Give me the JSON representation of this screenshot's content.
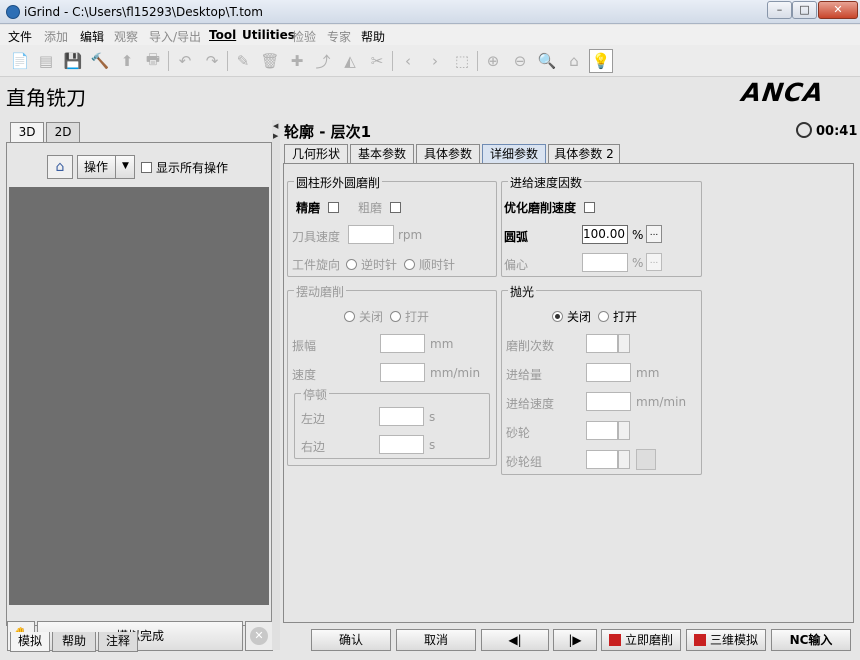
{
  "window": {
    "title": "iGrind - C:\\Users\\fl15293\\Desktop\\T.tom",
    "min": "–",
    "max": "□",
    "close": "✕"
  },
  "menu": [
    {
      "label": "文件",
      "enabled": true
    },
    {
      "label": "添加",
      "enabled": false
    },
    {
      "label": "编辑",
      "enabled": true
    },
    {
      "label": "观察",
      "enabled": false
    },
    {
      "label": "导入/导出",
      "enabled": false
    },
    {
      "label": "Tool",
      "enabled": true
    },
    {
      "label": "Utilities",
      "enabled": true
    },
    {
      "label": "检验",
      "enabled": false
    },
    {
      "label": "专家",
      "enabled": false
    },
    {
      "label": "帮助",
      "enabled": true
    }
  ],
  "toolbar": {
    "new": "📄",
    "open": "▤",
    "save": "💾",
    "tool": "🔨",
    "export": "⬆",
    "print": "🖶",
    "undo": "↶",
    "redo": "↷",
    "edit": "✎",
    "delete": "🗑",
    "add": "✚",
    "sweep": "⤴",
    "mirror": "◭",
    "cut": "✂",
    "prev": "‹",
    "next": "›",
    "fit": "⬚",
    "zoom_in": "⊕",
    "zoom_out": "⊖",
    "zoom": "🔍",
    "home": "⌂",
    "tip": "💡"
  },
  "page_title": "直角铣刀",
  "brand": "ANCA",
  "left": {
    "tabs": [
      "3D",
      "2D"
    ],
    "home_icon": "⌂",
    "operation": "操作",
    "dropdown_arrow": "▼",
    "show_all": "显示所有操作",
    "hand_icon": "✋",
    "sim_done": "模拟完成",
    "stop_icon": "✕",
    "bottom_tabs": [
      "模拟",
      "帮助",
      "注释"
    ]
  },
  "splitter": {
    "left_arrow": "◀",
    "right_arrow": "▶"
  },
  "section_title": "轮廓  - 层次1",
  "timer": "00:41",
  "tabs": [
    "几何形状",
    "基本参数",
    "具体参数",
    "详细参数",
    "具体参数 2"
  ],
  "selected_tab": 3,
  "cyl": {
    "title": "圆柱形外圆磨削",
    "finish": "精磨",
    "rough": "粗磨",
    "wheel_speed": "刀具速度",
    "wheel_speed_unit": "rpm",
    "work_dir": "工件旋向",
    "ccw": "逆时针",
    "cw": "顺时针"
  },
  "feed": {
    "title": "进给速度因数",
    "optimize": "优化磨削速度",
    "arc": "圆弧",
    "arc_value": "100.00",
    "arc_unit": "%",
    "eccentric": "偏心",
    "ecc_unit": "%",
    "dots": "..."
  },
  "osc": {
    "title": "摆动磨削",
    "off": "关闭",
    "on": "打开",
    "amp": "振幅",
    "amp_unit": "mm",
    "speed": "速度",
    "speed_unit": "mm/min",
    "dwell": "停顿",
    "left": "左边",
    "left_unit": "s",
    "right": "右边",
    "right_unit": "s"
  },
  "polish": {
    "title": "抛光",
    "off": "关闭",
    "on": "打开",
    "passes": "磨削次数",
    "feed": "进给量",
    "feed_unit": "mm",
    "feed_rate": "进给速度",
    "feed_rate_unit": "mm/min",
    "wheel": "砂轮",
    "wheel_set": "砂轮组"
  },
  "footer": {
    "ok": "确认",
    "cancel": "取消",
    "prev": "◀|",
    "next": "|▶",
    "grind_now": "立即磨削",
    "sim3d": "三维模拟",
    "nc_input": "NC输入"
  }
}
